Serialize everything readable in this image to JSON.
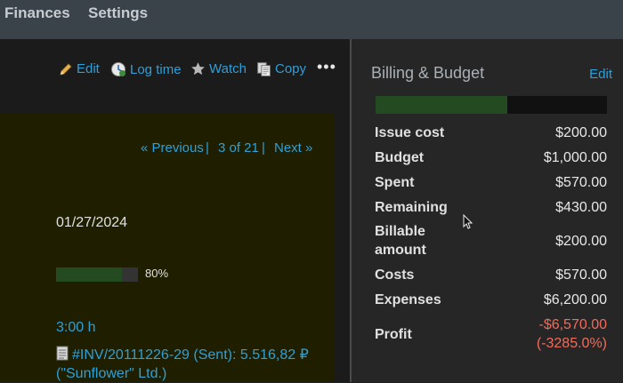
{
  "topnav": {
    "items": [
      "Finances",
      "Settings"
    ]
  },
  "actions": {
    "edit": "Edit",
    "log_time": "Log time",
    "watch": "Watch",
    "copy": "Copy",
    "more": "•••"
  },
  "pager": {
    "previous": "« Previous",
    "position": "3 of 21",
    "next": "Next »",
    "sep": "|"
  },
  "issue": {
    "date": "01/27/2024",
    "progress_percent": 80,
    "progress_label": "80%",
    "time": "3:00 h",
    "invoice": "#INV/20111226-29 (Sent): 5.516,82 ₽ (\"Sunflower\" Ltd.)"
  },
  "billing": {
    "title": "Billing & Budget",
    "edit": "Edit",
    "budget_used_fraction": 0.57,
    "rows": [
      {
        "label": "Issue cost",
        "value": "$200.00"
      },
      {
        "label": "Budget",
        "value": "$1,000.00"
      },
      {
        "label": "Spent",
        "value": "$570.00"
      },
      {
        "label": "Remaining",
        "value": "$430.00"
      },
      {
        "label": "Billable amount",
        "value": "$200.00"
      },
      {
        "label": "Costs",
        "value": "$570.00"
      },
      {
        "label": "Expenses",
        "value": "$6,200.00"
      },
      {
        "label": "Profit",
        "value": "-$6,570.00",
        "value2": "(-3285.0%)"
      }
    ]
  },
  "colors": {
    "link": "#2f9fd8",
    "negative": "#f26b5b",
    "progress": "#244a22"
  }
}
